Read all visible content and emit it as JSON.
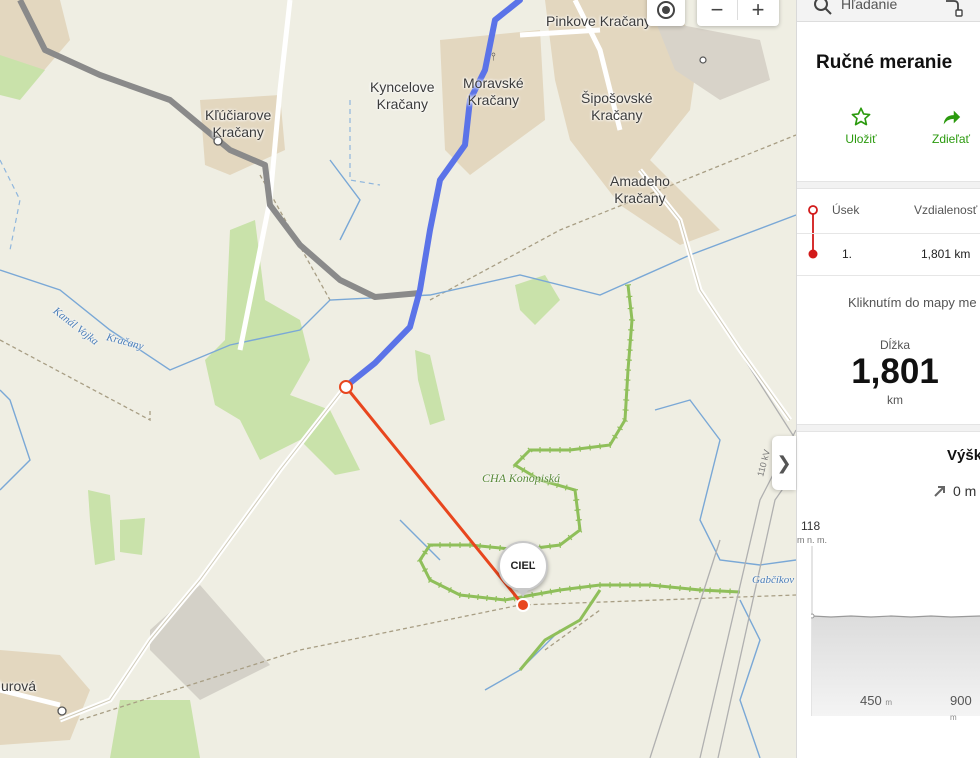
{
  "map": {
    "places": {
      "klucarove": "Kľúčiarove\nKračany",
      "kyncelove": "Kyncelove\nKračany",
      "moravske": "Moravské\nKračany",
      "pinkove": "Pinkove Kračany",
      "siposovske": "Šipošovské\nKračany",
      "amadeho": "Amadeho\nKračany",
      "jurova": "Jurová"
    },
    "water_labels": {
      "kanal": "Kanál Vojka",
      "kracany": "Kračany",
      "gabcikov": "Gabčíkov"
    },
    "reserve_label": "CHA Konopiská",
    "rail_label": "110 kV",
    "marker_label": "CIEĽ",
    "controls": {
      "locate_icon": "target-icon",
      "zoom_out": "−",
      "zoom_in": "+"
    },
    "colors": {
      "route_blue": "#5b73e8",
      "measure_red": "#e8461e",
      "main_road": "#8a8a8a",
      "settlement": "#e3d7bf",
      "forest": "#c9e2aa",
      "water": "#7aa8d6"
    }
  },
  "panel": {
    "search_text": "Hľadanie",
    "title": "Ručné meranie",
    "actions": [
      {
        "label": "Uložiť",
        "icon": "star-icon"
      },
      {
        "label": "Zdieľať",
        "icon": "share-arrow-icon"
      }
    ],
    "table": {
      "col_segment": "Úsek",
      "col_distance": "Vzdialenosť",
      "row_segment": "1.",
      "row_distance": "1,801 km"
    },
    "hint": "Kliknutím do mapy me",
    "length": {
      "label": "Dĺžka",
      "value": "1,801",
      "unit": "km"
    },
    "elevation": {
      "title": "Výšk",
      "ascent": "0 m",
      "max": "118",
      "max_unit": "m n. m.",
      "x_ticks": [
        "450",
        "900"
      ],
      "x_unit": "m"
    },
    "collapse_icon": "chevron-right-icon"
  }
}
